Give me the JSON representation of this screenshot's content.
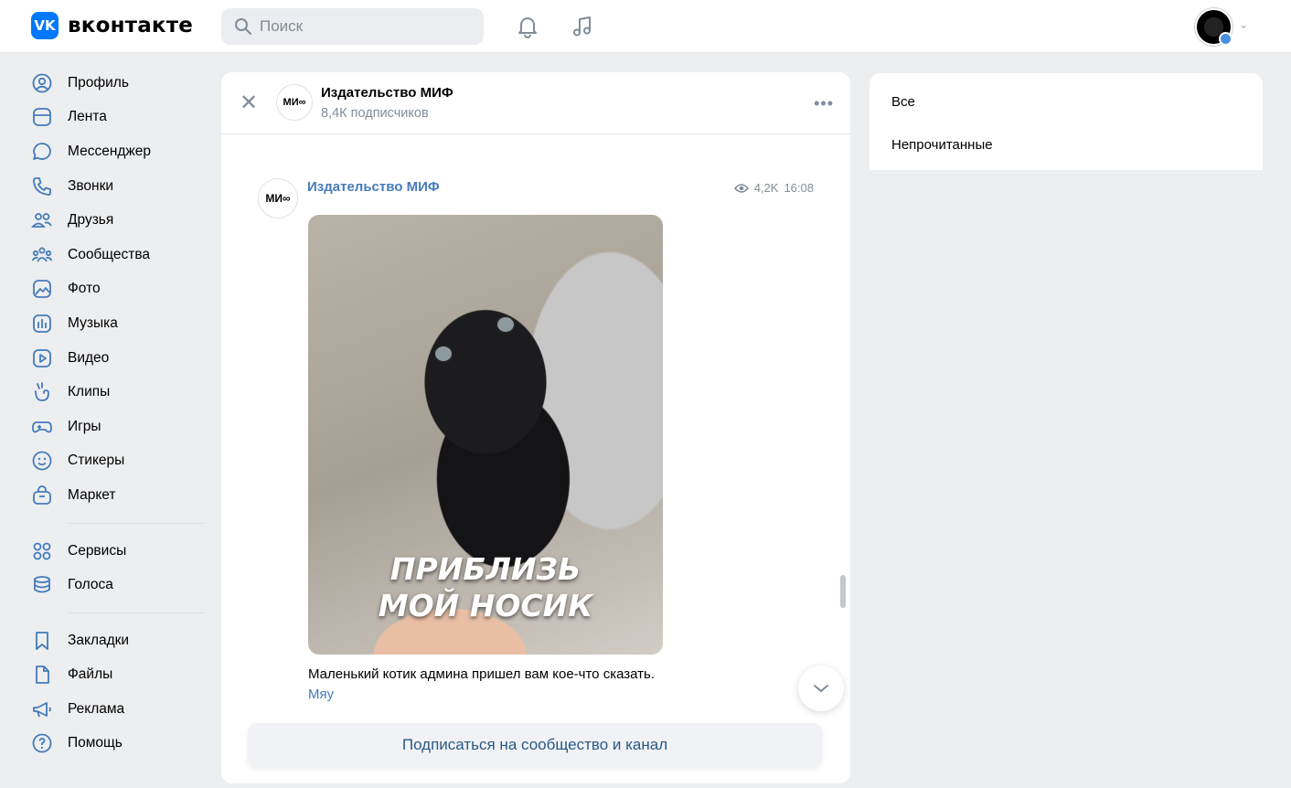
{
  "header": {
    "logo_text": "вконтакте",
    "logo_mark": "VK",
    "search_placeholder": "Поиск",
    "icons": [
      "bell-icon",
      "music-note-icon"
    ]
  },
  "sidebar": {
    "items": [
      {
        "label": "Профиль",
        "icon": "profile-icon"
      },
      {
        "label": "Лента",
        "icon": "feed-icon"
      },
      {
        "label": "Мессенджер",
        "icon": "messenger-icon"
      },
      {
        "label": "Звонки",
        "icon": "phone-icon"
      },
      {
        "label": "Друзья",
        "icon": "friends-icon"
      },
      {
        "label": "Сообщества",
        "icon": "communities-icon"
      },
      {
        "label": "Фото",
        "icon": "photo-icon"
      },
      {
        "label": "Музыка",
        "icon": "music-icon"
      },
      {
        "label": "Видео",
        "icon": "video-icon"
      },
      {
        "label": "Клипы",
        "icon": "clips-icon"
      },
      {
        "label": "Игры",
        "icon": "games-icon"
      },
      {
        "label": "Стикеры",
        "icon": "stickers-icon"
      },
      {
        "label": "Маркет",
        "icon": "market-icon"
      }
    ],
    "group2": [
      {
        "label": "Сервисы",
        "icon": "services-icon"
      },
      {
        "label": "Голоса",
        "icon": "votes-icon"
      }
    ],
    "group3": [
      {
        "label": "Закладки",
        "icon": "bookmarks-icon"
      },
      {
        "label": "Файлы",
        "icon": "files-icon"
      },
      {
        "label": "Реклама",
        "icon": "ads-icon"
      },
      {
        "label": "Помощь",
        "icon": "help-icon"
      }
    ]
  },
  "channel": {
    "title": "Издательство МИФ",
    "subscribers": "8,4К подписчиков",
    "avatar_text": "МИ∞"
  },
  "post": {
    "author": "Издательство МИФ",
    "views": "4,2K",
    "time": "16:08",
    "image_caption_line1": "ПРИБЛИЗЬ",
    "image_caption_line2": "МОЙ НОСИК",
    "text": "Маленький котик админа пришел вам кое-что сказать.",
    "more": "Мяу"
  },
  "subscribe_label": "Подписаться на сообщество и канал",
  "filters": {
    "all": "Все",
    "unread": "Непрочитанные"
  },
  "colors": {
    "accent": "#447bba",
    "brand": "#0077ff",
    "background": "#edeef0"
  }
}
